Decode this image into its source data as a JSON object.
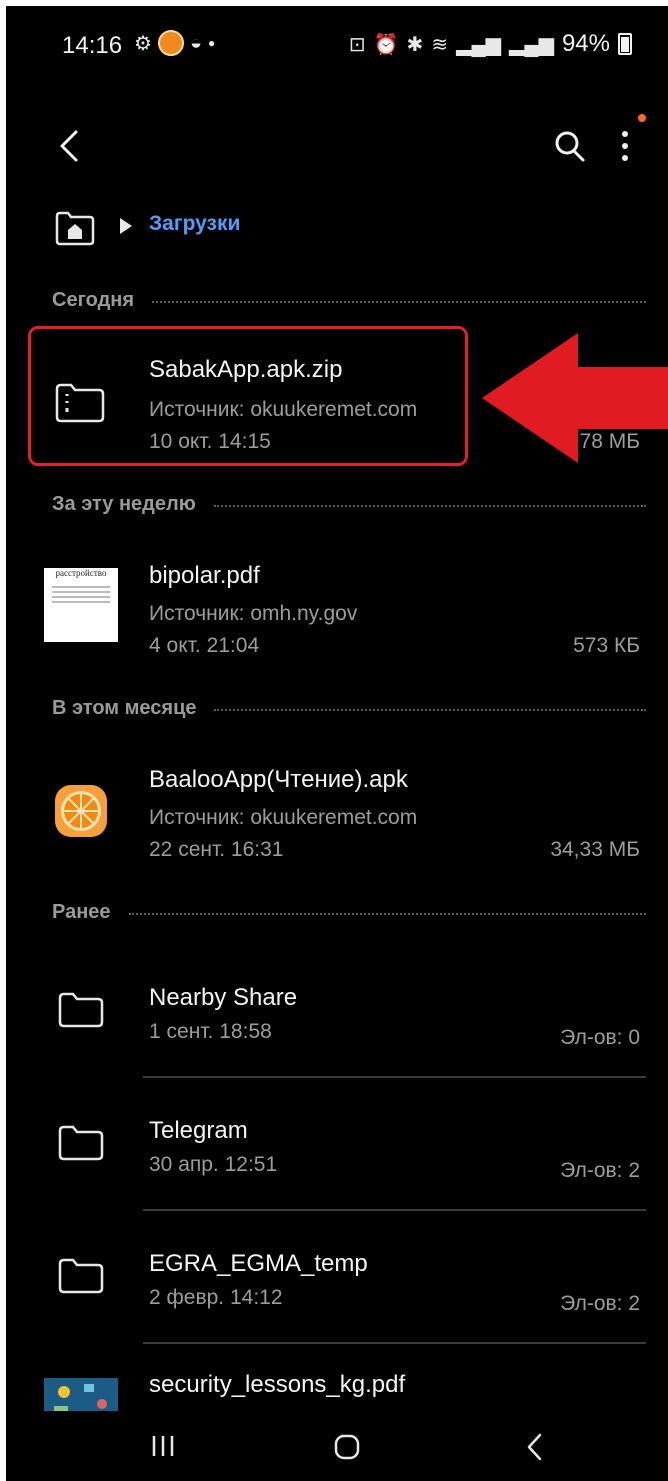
{
  "status_bar": {
    "time": "14:16",
    "battery": "94%"
  },
  "breadcrumb": {
    "current": "Загрузки"
  },
  "sections": {
    "today": "Сегодня",
    "this_week": "За эту неделю",
    "this_month": "В этом месяце",
    "earlier": "Ранее"
  },
  "files": [
    {
      "name": "SabakApp.apk.zip",
      "source": "Источник: okuukeremet.com",
      "date": "10 окт. 14:15",
      "size": "78 МБ",
      "icon": "archive-folder-icon"
    },
    {
      "name": "bipolar.pdf",
      "source": "Источник: omh.ny.gov",
      "date": "4 окт. 21:04",
      "size": "573 КБ",
      "icon": "pdf-thumbnail",
      "thumb_title": "расстройство"
    },
    {
      "name": "BaalooApp(Чтение).apk",
      "source": "Источник: okuukeremet.com",
      "date": "22 сент. 16:31",
      "size": "34,33 МБ",
      "icon": "orange-app-icon"
    },
    {
      "name": "Nearby Share",
      "date": "1 сент. 18:58",
      "size": "Эл-ов: 0",
      "icon": "folder-icon"
    },
    {
      "name": "Telegram",
      "date": "30 апр. 12:51",
      "size": "Эл-ов: 2",
      "icon": "folder-icon"
    },
    {
      "name": "EGRA_EGMA_temp",
      "date": "2 февр. 14:12",
      "size": "Эл-ов: 2",
      "icon": "folder-icon"
    },
    {
      "name": "security_lessons_kg.pdf",
      "icon": "pdf-thumbnail"
    }
  ],
  "colors": {
    "background": "#000000",
    "accent": "#4f9ef7",
    "highlight": "#e32028",
    "notification_dot": "#ff6a2a"
  }
}
